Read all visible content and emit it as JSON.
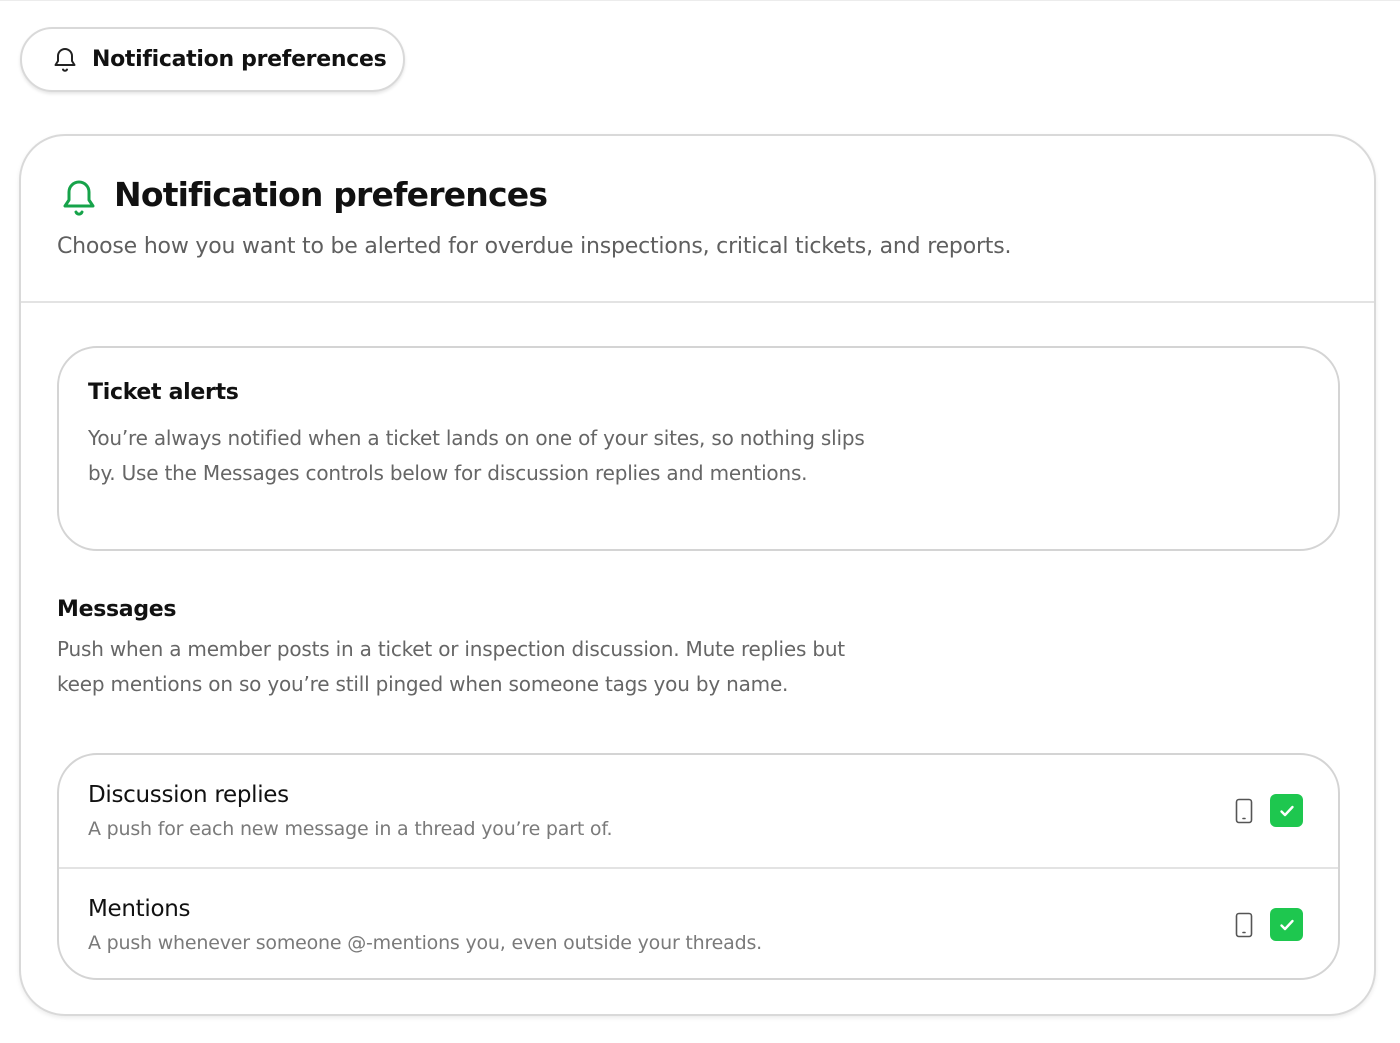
{
  "header_pill": {
    "icon": "bell-icon",
    "label": "Notification preferences"
  },
  "card": {
    "icon": "bell-icon",
    "title": "Notification preferences",
    "subtitle": "Choose how you want to be alerted for overdue inspections, critical tickets, and reports."
  },
  "ticket_alerts": {
    "title": "Ticket alerts",
    "description": "You’re always notified when a ticket lands on one of your sites, so nothing slips by. Use the Messages controls below for discussion replies and mentions."
  },
  "messages": {
    "title": "Messages",
    "description": "Push when a member posts in a ticket or inspection discussion. Mute replies but keep mentions on so you’re still pinged when someone tags you by name.",
    "options": [
      {
        "title": "Discussion replies",
        "description": "A push for each new message in a thread you’re part of.",
        "channel_icon": "phone-icon",
        "checked": true
      },
      {
        "title": "Mentions",
        "description": "A push whenever someone @-mentions you, even outside your threads.",
        "channel_icon": "phone-icon",
        "checked": true
      }
    ]
  },
  "colors": {
    "accent_green": "#1ec74f",
    "bell_green": "#16a34a",
    "text_muted": "#666666",
    "border": "#d4d4d4"
  }
}
